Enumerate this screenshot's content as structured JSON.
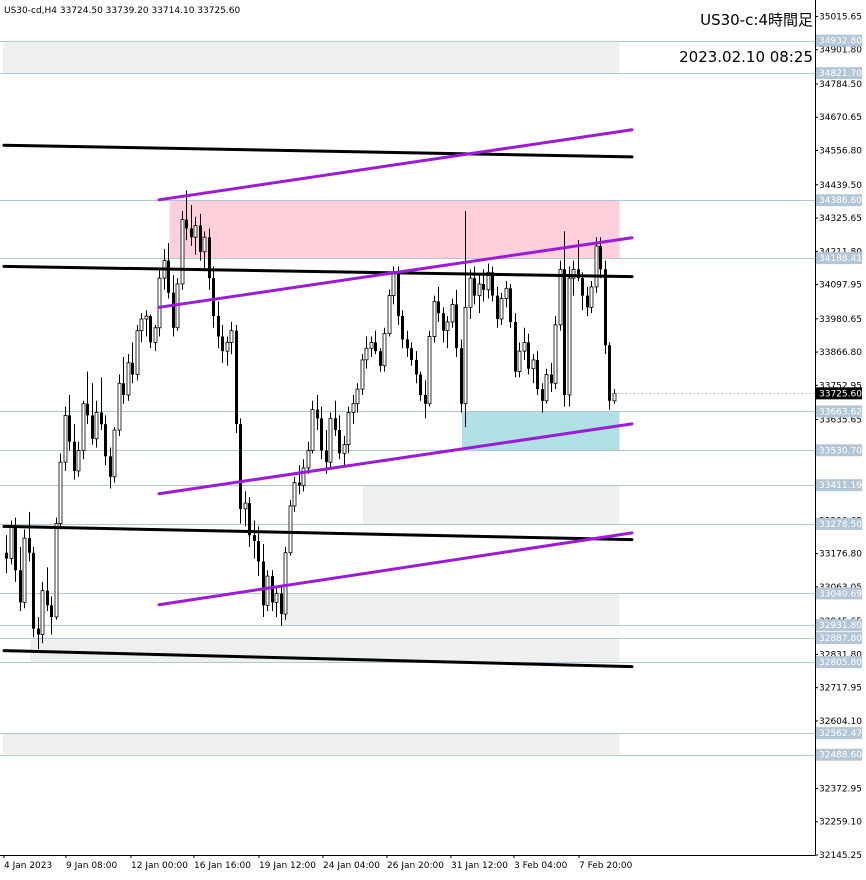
{
  "header": {
    "symbol_info": "US30-cd,H4  33724.50 33739.20 33714.10 33725.60",
    "title": "US30-c:4時間足",
    "timestamp": "2023.02.10 08:25"
  },
  "colors": {
    "background": "#ffffff",
    "candle": "#000000",
    "hline": "#b3c6d6",
    "hline_tag_bg": "#b3c6d6",
    "current_tag_bg": "#000000",
    "zone_gray": "#efefef",
    "zone_pink": "#ffd0dc",
    "zone_cyan": "#b0dfe5",
    "trend_black": "#000000",
    "trend_purple": "#9a1cd8"
  },
  "chart_data": {
    "type": "candlestick",
    "symbol": "US30-cd",
    "timeframe": "H4",
    "ylim": [
      32145.25,
      35072.0
    ],
    "y_ticks": [
      "35015.65",
      "34901.80",
      "34784.50",
      "34670.65",
      "34556.80",
      "34439.50",
      "34325.65",
      "34211.80",
      "34097.95",
      "33980.65",
      "33866.80",
      "33752.95",
      "33635.65",
      "33521.80",
      "33408.05",
      "33290.65",
      "33176.80",
      "33063.05",
      "32945.65",
      "32831.80",
      "32717.95",
      "32604.10",
      "32486.80",
      "32372.95",
      "32259.10",
      "32145.25"
    ],
    "x_ticks": [
      "4 Jan 2023",
      "9 Jan 08:00",
      "12 Jan 00:00",
      "16 Jan 16:00",
      "19 Jan 12:00",
      "24 Jan 04:00",
      "26 Jan 20:00",
      "31 Jan 12:00",
      "3 Feb 04:00",
      "7 Feb 20:00"
    ],
    "current_price": "33725.60",
    "horizontal_levels": [
      "34932.80",
      "34821.70",
      "34386.60",
      "34188.41",
      "33663.62",
      "33530.70",
      "33411.19",
      "33278.50",
      "33040.69",
      "32931.80",
      "32887.80",
      "32805.80",
      "32562.47",
      "32488.60"
    ],
    "ohlc": [
      [
        33180,
        33240,
        33110,
        33160
      ],
      [
        33160,
        33290,
        33140,
        33270
      ],
      [
        33270,
        33300,
        33080,
        33120
      ],
      [
        33120,
        33200,
        32980,
        33010
      ],
      [
        33010,
        33260,
        32990,
        33230
      ],
      [
        33230,
        33320,
        33150,
        33180
      ],
      [
        33180,
        33200,
        32890,
        32920
      ],
      [
        32920,
        32960,
        32850,
        32900
      ],
      [
        32900,
        33080,
        32870,
        33050
      ],
      [
        33050,
        33130,
        32980,
        33000
      ],
      [
        33000,
        33030,
        32900,
        32960
      ],
      [
        32960,
        33300,
        32950,
        33280
      ],
      [
        33280,
        33520,
        33260,
        33490
      ],
      [
        33490,
        33680,
        33460,
        33650
      ],
      [
        33650,
        33720,
        33530,
        33560
      ],
      [
        33560,
        33620,
        33430,
        33460
      ],
      [
        33460,
        33560,
        33440,
        33530
      ],
      [
        33530,
        33700,
        33500,
        33690
      ],
      [
        33690,
        33800,
        33620,
        33650
      ],
      [
        33650,
        33760,
        33550,
        33570
      ],
      [
        33570,
        33700,
        33540,
        33660
      ],
      [
        33660,
        33780,
        33600,
        33620
      ],
      [
        33620,
        33650,
        33480,
        33510
      ],
      [
        33510,
        33540,
        33400,
        33440
      ],
      [
        33440,
        33610,
        33420,
        33600
      ],
      [
        33600,
        33790,
        33580,
        33760
      ],
      [
        33760,
        33850,
        33690,
        33720
      ],
      [
        33720,
        33860,
        33700,
        33830
      ],
      [
        33830,
        33900,
        33760,
        33790
      ],
      [
        33790,
        33960,
        33770,
        33940
      ],
      [
        33940,
        34000,
        33900,
        33980
      ],
      [
        33980,
        34010,
        33920,
        33990
      ],
      [
        33990,
        33995,
        33880,
        33900
      ],
      [
        33900,
        33960,
        33870,
        33950
      ],
      [
        33950,
        34150,
        33920,
        34120
      ],
      [
        34120,
        34220,
        34080,
        34180
      ],
      [
        34180,
        34240,
        34050,
        34070
      ],
      [
        34070,
        34130,
        33920,
        33950
      ],
      [
        33950,
        34120,
        33940,
        34100
      ],
      [
        34100,
        34350,
        34080,
        34320
      ],
      [
        34320,
        34420,
        34250,
        34290
      ],
      [
        34290,
        34370,
        34230,
        34260
      ],
      [
        34260,
        34330,
        34200,
        34300
      ],
      [
        34300,
        34340,
        34180,
        34210
      ],
      [
        34210,
        34280,
        34150,
        34260
      ],
      [
        34260,
        34290,
        34080,
        34120
      ],
      [
        34120,
        34160,
        33950,
        33990
      ],
      [
        33990,
        34040,
        33880,
        33920
      ],
      [
        33920,
        33960,
        33830,
        33870
      ],
      [
        33870,
        33920,
        33820,
        33900
      ],
      [
        33900,
        33970,
        33860,
        33940
      ],
      [
        33940,
        33960,
        33590,
        33620
      ],
      [
        33620,
        33640,
        33280,
        33330
      ],
      [
        33330,
        33390,
        33270,
        33350
      ],
      [
        33350,
        33370,
        33200,
        33240
      ],
      [
        33240,
        33290,
        33160,
        33220
      ],
      [
        33220,
        33270,
        33100,
        33150
      ],
      [
        33150,
        33210,
        32960,
        33000
      ],
      [
        33000,
        33120,
        32980,
        33100
      ],
      [
        33100,
        33120,
        32980,
        33010
      ],
      [
        33010,
        33060,
        32960,
        33040
      ],
      [
        33040,
        33070,
        32930,
        32970
      ],
      [
        32970,
        33200,
        32950,
        33180
      ],
      [
        33180,
        33360,
        33170,
        33340
      ],
      [
        33340,
        33440,
        33320,
        33420
      ],
      [
        33420,
        33480,
        33380,
        33410
      ],
      [
        33410,
        33500,
        33390,
        33470
      ],
      [
        33470,
        33560,
        33450,
        33530
      ],
      [
        33530,
        33700,
        33520,
        33670
      ],
      [
        33670,
        33720,
        33600,
        33640
      ],
      [
        33640,
        33680,
        33500,
        33530
      ],
      [
        33530,
        33600,
        33450,
        33490
      ],
      [
        33490,
        33660,
        33470,
        33640
      ],
      [
        33640,
        33700,
        33580,
        33600
      ],
      [
        33600,
        33650,
        33500,
        33520
      ],
      [
        33520,
        33580,
        33480,
        33550
      ],
      [
        33550,
        33680,
        33520,
        33660
      ],
      [
        33660,
        33720,
        33620,
        33690
      ],
      [
        33690,
        33760,
        33660,
        33740
      ],
      [
        33740,
        33860,
        33720,
        33840
      ],
      [
        33840,
        33920,
        33810,
        33880
      ],
      [
        33880,
        33920,
        33850,
        33900
      ],
      [
        33900,
        33940,
        33860,
        33870
      ],
      [
        33870,
        33880,
        33800,
        33820
      ],
      [
        33820,
        33950,
        33800,
        33930
      ],
      [
        33930,
        34080,
        33920,
        34060
      ],
      [
        34060,
        34160,
        34030,
        34140
      ],
      [
        34140,
        34160,
        33960,
        33990
      ],
      [
        33990,
        34010,
        33880,
        33910
      ],
      [
        33910,
        33940,
        33850,
        33880
      ],
      [
        33880,
        33900,
        33820,
        33840
      ],
      [
        33840,
        33870,
        33760,
        33790
      ],
      [
        33790,
        33800,
        33700,
        33720
      ],
      [
        33720,
        33770,
        33640,
        33690
      ],
      [
        33690,
        33940,
        33680,
        33920
      ],
      [
        33920,
        34060,
        33900,
        34040
      ],
      [
        34040,
        34090,
        33970,
        34000
      ],
      [
        34000,
        34020,
        33900,
        33940
      ],
      [
        33940,
        33990,
        33880,
        33970
      ],
      [
        33970,
        34050,
        33950,
        34030
      ],
      [
        34030,
        34080,
        33850,
        33880
      ],
      [
        33880,
        33910,
        33660,
        33690
      ],
      [
        33690,
        34350,
        33610,
        34020
      ],
      [
        34020,
        34150,
        33980,
        34120
      ],
      [
        34120,
        34160,
        34030,
        34060
      ],
      [
        34060,
        34130,
        34000,
        34100
      ],
      [
        34100,
        34150,
        34040,
        34080
      ],
      [
        34080,
        34170,
        34050,
        34140
      ],
      [
        34140,
        34160,
        34040,
        34060
      ],
      [
        34060,
        34090,
        33950,
        33980
      ],
      [
        33980,
        34070,
        33960,
        34050
      ],
      [
        34050,
        34110,
        34020,
        34085
      ],
      [
        34085,
        34100,
        33950,
        33970
      ],
      [
        33970,
        34000,
        33780,
        33800
      ],
      [
        33800,
        33900,
        33780,
        33870
      ],
      [
        33870,
        33950,
        33840,
        33900
      ],
      [
        33900,
        33930,
        33790,
        33810
      ],
      [
        33810,
        33860,
        33760,
        33840
      ],
      [
        33840,
        33870,
        33720,
        33740
      ],
      [
        33740,
        33760,
        33660,
        33700
      ],
      [
        33700,
        33810,
        33690,
        33790
      ],
      [
        33790,
        33830,
        33730,
        33760
      ],
      [
        33760,
        33990,
        33740,
        33960
      ],
      [
        33960,
        34180,
        33940,
        34150
      ],
      [
        34150,
        34280,
        33680,
        33720
      ],
      [
        33720,
        34160,
        33680,
        34120
      ],
      [
        34120,
        34180,
        34060,
        34150
      ],
      [
        34150,
        34250,
        34110,
        34120
      ],
      [
        34120,
        34140,
        34010,
        34060
      ],
      [
        34060,
        34090,
        33990,
        34020
      ],
      [
        34020,
        34110,
        34000,
        34090
      ],
      [
        34090,
        34260,
        34070,
        34230
      ],
      [
        34230,
        34260,
        34120,
        34150
      ],
      [
        34150,
        34180,
        33860,
        33890
      ],
      [
        33890,
        33900,
        33670,
        33700
      ],
      [
        33700,
        33740,
        33690,
        33725
      ]
    ],
    "zones": [
      {
        "color": "gray",
        "from_bar": 0,
        "to_bar": 135,
        "price_low": 34821.7,
        "price_high": 34932.8
      },
      {
        "color": "pink",
        "from_bar": 37,
        "to_bar": 135,
        "price_low": 34188.41,
        "price_high": 34386.6
      },
      {
        "color": "cyan",
        "from_bar": 102,
        "to_bar": 135,
        "price_low": 33530.7,
        "price_high": 33663.62
      },
      {
        "color": "gray",
        "from_bar": 80,
        "to_bar": 135,
        "price_low": 33278.5,
        "price_high": 33411.19
      },
      {
        "color": "gray",
        "from_bar": 62,
        "to_bar": 135,
        "price_low": 32931.8,
        "price_high": 33040.69
      },
      {
        "color": "gray",
        "from_bar": 6,
        "to_bar": 135,
        "price_low": 32805.8,
        "price_high": 32887.8
      },
      {
        "color": "gray",
        "from_bar": 0,
        "to_bar": 135,
        "price_low": 32488.6,
        "price_high": 32562.47
      }
    ],
    "trendlines": [
      {
        "color": "black",
        "from": [
          0,
          34575
        ],
        "to": [
          141,
          34535
        ]
      },
      {
        "color": "black",
        "from": [
          0,
          34160
        ],
        "to": [
          141,
          34125
        ]
      },
      {
        "color": "black",
        "from": [
          0,
          33270
        ],
        "to": [
          141,
          33225
        ]
      },
      {
        "color": "black",
        "from": [
          0,
          32845
        ],
        "to": [
          141,
          32790
        ]
      },
      {
        "color": "purple",
        "from": [
          34,
          34388
        ],
        "to": [
          141,
          34628
        ]
      },
      {
        "color": "purple",
        "from": [
          34,
          34020
        ],
        "to": [
          141,
          34258
        ]
      },
      {
        "color": "purple",
        "from": [
          34,
          33382
        ],
        "to": [
          141,
          33621
        ]
      },
      {
        "color": "purple",
        "from": [
          34,
          33002
        ],
        "to": [
          141,
          33248
        ]
      }
    ]
  }
}
